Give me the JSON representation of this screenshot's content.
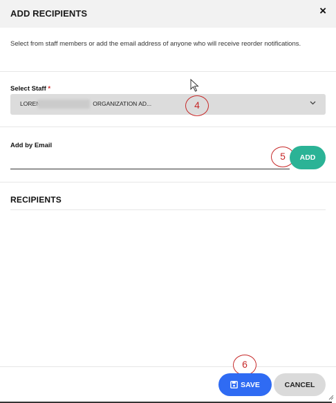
{
  "dialog": {
    "title": "ADD RECIPIENTS",
    "close_glyph": "×",
    "description": "Select from staff members or add the email address of anyone who will receive reorder notifications."
  },
  "select_staff": {
    "label": "Select Staff",
    "required_mark": "*",
    "value_prefix": "LORENA",
    "value_suffix": "ORGANIZATION AD...",
    "chevron_icon": "chevron-down-icon"
  },
  "add_by_email": {
    "label": "Add by Email",
    "value": "",
    "button_label": "ADD"
  },
  "recipients": {
    "title": "RECIPIENTS",
    "items": []
  },
  "footer": {
    "save_label": "SAVE",
    "cancel_label": "CANCEL"
  },
  "annotations": {
    "step_4": "4",
    "step_5": "5",
    "step_6": "6"
  },
  "colors": {
    "add_button": "#2bb396",
    "save_button": "#2f6bf3",
    "marker": "#c62828"
  }
}
